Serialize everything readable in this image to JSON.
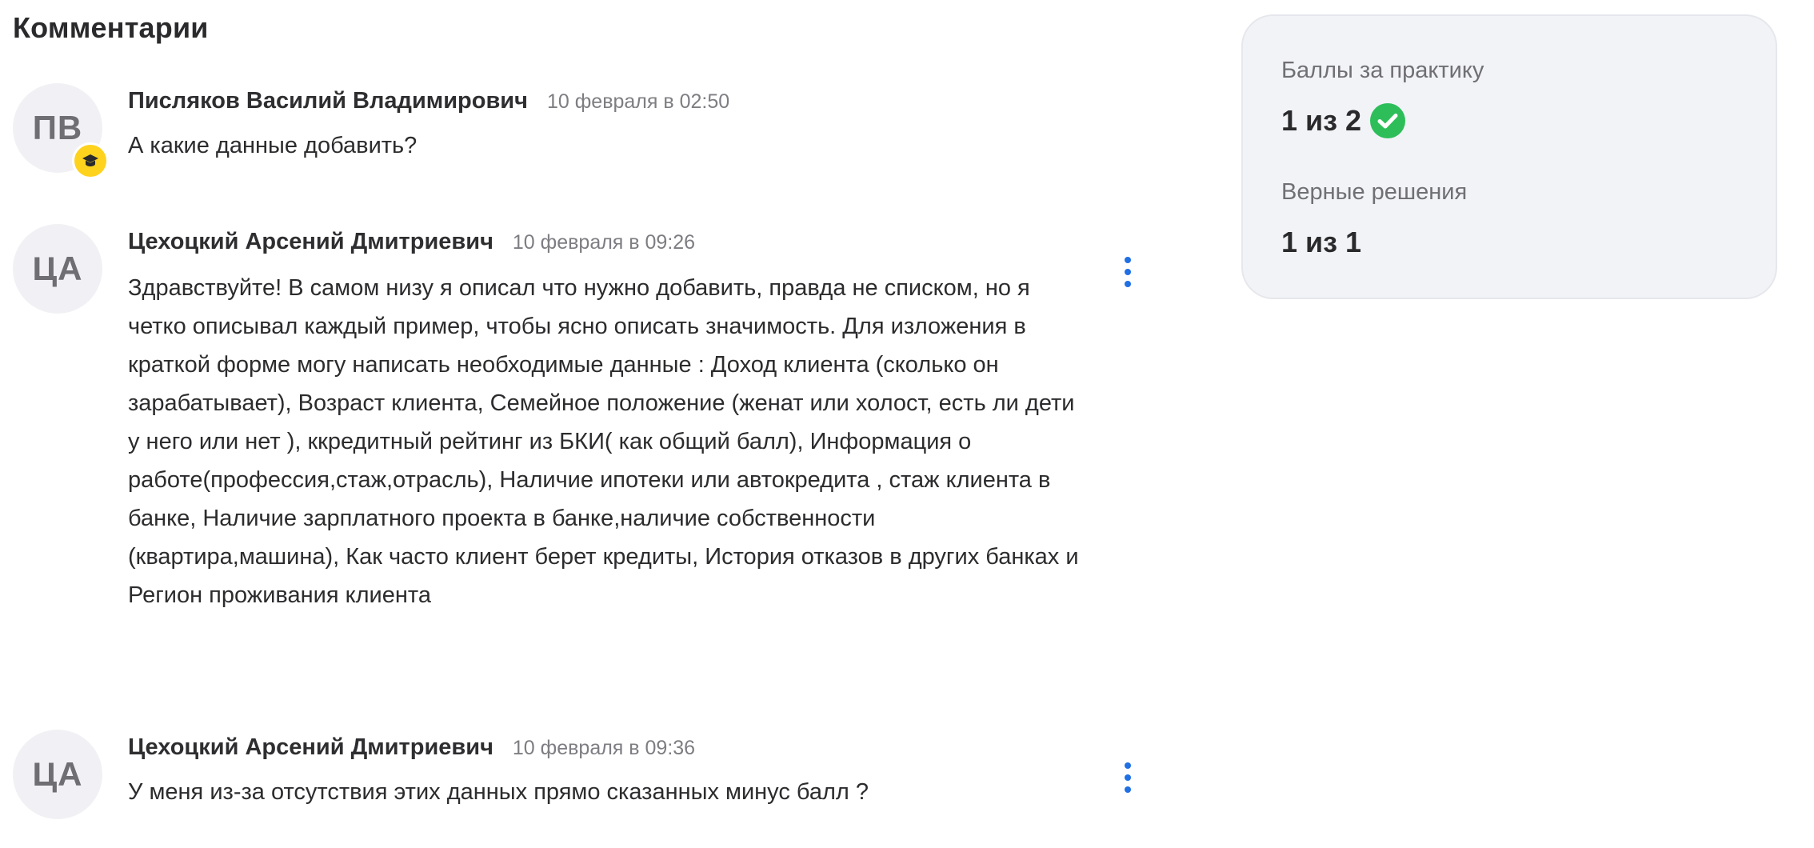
{
  "page": {
    "title": "Комментарии"
  },
  "comments": [
    {
      "initials": "ПВ",
      "author": "Писляков Василий Владимирович",
      "time": "10 февраля в 02:50",
      "text": "А какие данные добавить?",
      "badge_icon": "graduation-cap-icon",
      "badge_color": "#FFD21E"
    },
    {
      "initials": "ЦА",
      "author": "Цехоцкий Арсений Дмитриевич",
      "time": "10 февраля в 09:26",
      "text": "Здравствуйте! В самом низу я описал что нужно добавить, правда не списком, но я четко описывал каждый пример, чтобы ясно описать значимость. Для изложения в краткой форме могу написать необходимые данные : Доход клиента (сколько он зарабатывает), Возраст клиента, Семейное положение (женат или холост, есть ли дети у него или нет ), ккредитный рейтинг из БКИ( как общий балл), Информация о работе(профессия,стаж,отрасль), Наличие ипотеки или автокредита , стаж клиента в банке, Наличие зарплатного проекта в банке,наличие собственности (квартира,машина), Как часто клиент берет кредиты, История отказов в других банках и Регион проживания клиента",
      "menu_icon": "more-vertical-icon"
    },
    {
      "initials": "ЦА",
      "author": "Цехоцкий Арсений Дмитриевич",
      "time": "10 февраля в 09:36",
      "text": "У меня из-за отсутствия этих данных прямо сказанных минус балл ?",
      "menu_icon": "more-vertical-icon"
    }
  ],
  "stats": {
    "practice_label": "Баллы за практику",
    "practice_value": "1 из 2",
    "practice_icon": "check-circle-icon",
    "solutions_label": "Верные решения",
    "solutions_value": "1 из 1"
  },
  "colors": {
    "accent": "#1F6FE5",
    "success": "#2DBE5A",
    "avatar_bg": "#F1F1F5",
    "card_bg": "#F2F3F7"
  }
}
